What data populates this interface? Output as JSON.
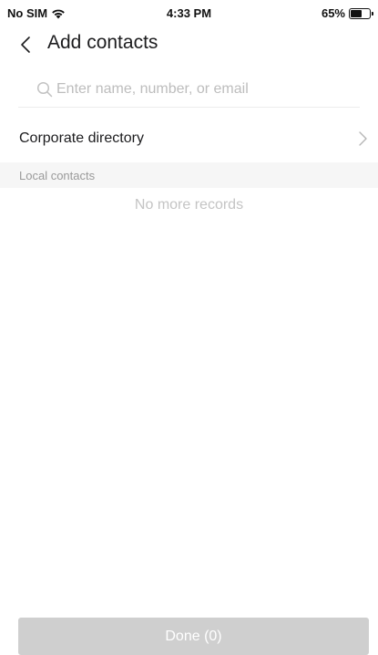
{
  "status_bar": {
    "carrier": "No SIM",
    "time": "4:33 PM",
    "battery": "65%",
    "battery_level": 0.65
  },
  "header": {
    "title": "Add contacts",
    "back_icon": "chevron-left-icon"
  },
  "search": {
    "placeholder": "Enter name, number, or email",
    "value": "",
    "icon": "search-icon"
  },
  "corporate_directory": {
    "label": "Corporate directory",
    "icon": "chevron-right-icon"
  },
  "local_contacts": {
    "section_label": "Local contacts",
    "empty_text": "No more records"
  },
  "footer": {
    "done_label": "Done (0)"
  },
  "colors": {
    "button_disabled": "#cfcfcf",
    "section_bg": "#f6f6f6",
    "muted_text": "#9a9a9a"
  }
}
